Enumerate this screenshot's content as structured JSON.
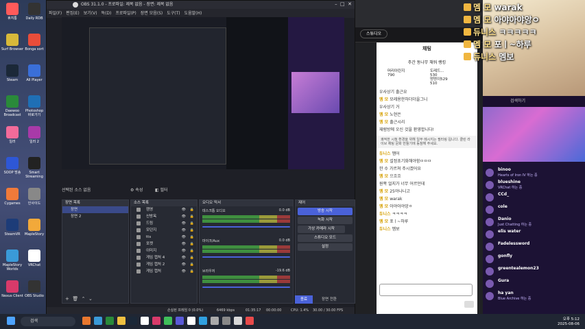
{
  "desktop_icons": [
    "휴지통",
    "Daily RDB",
    "Surf Browser",
    "Bonga sort",
    "Steam",
    "All Player",
    "Daewoo Broadcast",
    "Photoshop 바로가기",
    "일러",
    "일러 2",
    "SOOP 방송",
    "Smart Streaming",
    "Cygames",
    "인사이드",
    "SteamVR",
    "MapleStory",
    "MapleStory Worlds",
    "VRChat",
    "Nexus Client",
    "OBS Studio"
  ],
  "obs": {
    "title": "OBS 31.1.0 - 프로파일: 제목 없음 - 장면: 제목 없음",
    "menu": [
      "파일(F)",
      "편집(E)",
      "보기(V)",
      "독(D)",
      "프로파일(P)",
      "장면 모음(S)",
      "도구(T)",
      "도움말(H)"
    ],
    "source_bar": {
      "label": "선택된 소스 없음",
      "props": "속성",
      "filters": "필터"
    },
    "scenes": {
      "title": "장면 목록",
      "items": [
        "장면",
        "장면 2"
      ]
    },
    "sources": {
      "title": "소스 목록",
      "items": [
        "캠영",
        "신방옥",
        "드림",
        "모던지",
        "tts",
        "포켓",
        "이미지",
        "게임 캡처 4",
        "게임 캡처 2",
        "게임 캡처"
      ]
    },
    "mixer": {
      "title": "오디오 믹서",
      "channels": [
        {
          "name": "데스크톱 오디오",
          "db": "0.0 dB"
        },
        {
          "name": "마이크/Aux",
          "db": "0.0 dB"
        },
        {
          "name": "브라우저",
          "db": "-19.6 dB"
        }
      ]
    },
    "controls": {
      "title": "제어",
      "buttons": [
        "방송 시작",
        "녹화 시작",
        "가상 카메라 시작",
        "스튜디오 모드",
        "설정"
      ],
      "bottom": [
        "종료",
        "장면 전환"
      ]
    },
    "status": {
      "dropped": "손실된 프레임 0 (0.0%)",
      "bitrate": "6469 kbps",
      "time": "01:35:17",
      "rec": "00:00:00",
      "cpu": "CPU: 1.4%",
      "fps": "30.00 / 30.00 FPS"
    }
  },
  "chat": {
    "tab": "스튜디오",
    "title": "채팅",
    "ranking_title": "주간 동나무 채워 랭킹",
    "ranking": [
      {
        "name": "머리아린지",
        "value": "790"
      },
      {
        "name": "도레드...",
        "value": "530"
      },
      {
        "name": "멍멍이529",
        "value": "510"
      }
    ],
    "notice": "쾌적한 시청 환경을 위해 일부 메시지는 필터링 됩니다. 클린 라이브 채팅 문화 만들기에 동참해 주세요.",
    "messages": [
      {
        "n": "",
        "t": "우사상기 출근요"
      },
      {
        "n": "멤 모",
        "t": "모레용한하더더을그니"
      },
      {
        "n": "",
        "t": "우사상기 거"
      },
      {
        "n": "멤 모",
        "t": "노현은"
      },
      {
        "n": "멤 모",
        "t": "출근시리"
      },
      {
        "n": "",
        "t": "재럼방에 오신 것을 환영합니다!"
      },
      {
        "n": "듀니스",
        "t": "멤어"
      },
      {
        "n": "멤 모",
        "t": "설정초기화해야함ㅁㅁㅁ"
      },
      {
        "n": "",
        "t": "한 수 가르쳐 주시겠어요"
      },
      {
        "n": "멤 모",
        "t": "으흐흐"
      },
      {
        "n": "",
        "t": "원쪽 얼지가 너무 어르던데"
      },
      {
        "n": "멤 모",
        "t": "25야나니고"
      },
      {
        "n": "멤 모",
        "t": "warak"
      },
      {
        "n": "멤 모",
        "t": "아야아야앙ㅇ"
      },
      {
        "n": "듀니스",
        "t": "ㅋㅋㅋㅋ"
      },
      {
        "n": "멤 모",
        "t": "포ㅣ~하루"
      },
      {
        "n": "듀니스",
        "t": "멤보"
      }
    ]
  },
  "twitch": {
    "search": "검색하기",
    "viewers": [
      {
        "name": "binoo",
        "sub": "Hearts of Iron IV 하는 중"
      },
      {
        "name": "blueshine",
        "sub": "VRChat 하는 중"
      },
      {
        "name": "CCd_",
        "sub": ""
      },
      {
        "name": "cole",
        "sub": ""
      },
      {
        "name": "Danio",
        "sub": "Just Chatting 하는 중"
      },
      {
        "name": "elis water",
        "sub": ""
      },
      {
        "name": "Fadelessword",
        "sub": ""
      },
      {
        "name": "gonfly",
        "sub": ""
      },
      {
        "name": "greentealemon23",
        "sub": ""
      },
      {
        "name": "Gura",
        "sub": ""
      },
      {
        "name": "ha yan",
        "sub": "Blue Archive 하는 중"
      }
    ]
  },
  "overlay": [
    {
      "n": "멤 모",
      "t": "warak"
    },
    {
      "n": "멤 모",
      "t": "아야아야앙ㅇ"
    },
    {
      "n": "듀니스",
      "t": "ㅋㅋㅋㅋㅋ"
    },
    {
      "n": "멤 모",
      "t": "포ㅣ~하루"
    },
    {
      "n": "듀니스",
      "t": "멤보"
    }
  ],
  "taskbar": {
    "search": "검색",
    "time": "오후 5:12",
    "date": "2025-08-06"
  }
}
